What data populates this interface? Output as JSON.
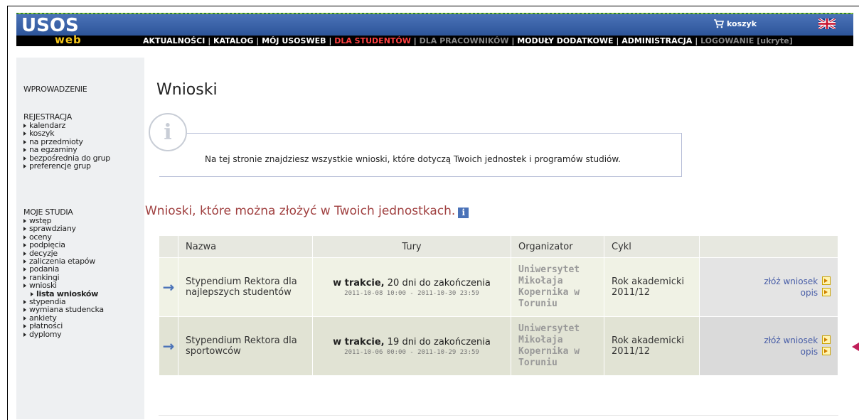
{
  "header": {
    "logo_main": "USOS",
    "logo_sub": "web",
    "cart_label": "koszyk",
    "nav": [
      {
        "label": "AKTUALNOŚCI",
        "state": "normal"
      },
      {
        "label": "KATALOG",
        "state": "normal"
      },
      {
        "label": "MÓJ USOSWEB",
        "state": "normal"
      },
      {
        "label": "DLA STUDENTÓW",
        "state": "active"
      },
      {
        "label": "DLA PRACOWNIKÓW",
        "state": "dim"
      },
      {
        "label": "MODUŁY DODATKOWE",
        "state": "normal"
      },
      {
        "label": "ADMINISTRACJA",
        "state": "normal"
      },
      {
        "label": "LOGOWANIE [ukryte]",
        "state": "dim"
      }
    ]
  },
  "sidebar": {
    "intro": "WPROWADZENIE",
    "rejestracja": {
      "title": "REJESTRACJA",
      "items": [
        "kalendarz",
        "koszyk",
        "na przedmioty",
        "na egzaminy",
        "bezpośrednia do grup",
        "preferencje grup"
      ]
    },
    "moje_studia": {
      "title": "MOJE STUDIA",
      "items": [
        "wstęp",
        "sprawdziany",
        "oceny",
        "podpięcia",
        "decyzje",
        "zaliczenia etapów",
        "podania",
        "rankingi",
        "wnioski"
      ],
      "sub_item": "lista wniosków",
      "items_after": [
        "stypendia",
        "wymiana studencka",
        "ankiety",
        "płatności",
        "dyplomy"
      ]
    }
  },
  "main": {
    "title": "Wnioski",
    "info_text": "Na tej stronie znajdziesz wszystkie wnioski, które dotyczą Twoich jednostek i programów studiów.",
    "subheading": "Wnioski, które można złożyć w Twoich jednostkach.",
    "table": {
      "headers": [
        "",
        "Nazwa",
        "Tury",
        "Organizator",
        "Cykl",
        ""
      ],
      "rows": [
        {
          "name": "Stypendium Rektora dla najlepszych studentów",
          "status": "w trakcie,",
          "remaining": "20 dni do zakończenia",
          "dates": "2011-10-08 10:00 - 2011-10-30 23:59",
          "organizer": "Uniwersytet Mikołaja Kopernika w Toruniu",
          "cycle": "Rok akademicki 2011/12",
          "action1": "złóż wniosek",
          "action2": "opis"
        },
        {
          "name": "Stypendium Rektora dla sportowców",
          "status": "w trakcie,",
          "remaining": "19 dni do zakończenia",
          "dates": "2011-10-06 00:00 - 2011-10-29 23:59",
          "organizer": "Uniwersytet Mikołaja Kopernika w Toruniu",
          "cycle": "Rok akademicki 2011/12",
          "action1": "złóż wniosek",
          "action2": "opis"
        }
      ]
    }
  },
  "colors": {
    "header_blue": "#2d5599",
    "nav_active": "#ff4040",
    "subheading": "#a04040",
    "link": "#4a5fa8"
  }
}
